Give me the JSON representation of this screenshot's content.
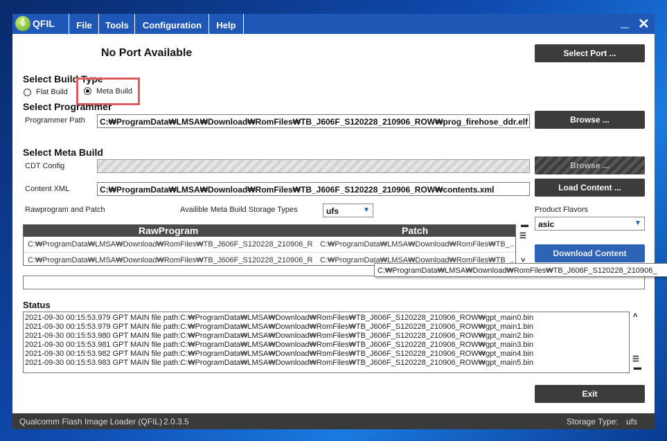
{
  "app": {
    "title": "QFIL",
    "menus": [
      "File",
      "Tools",
      "Configuration",
      "Help"
    ],
    "minimize": "_",
    "close": "✕"
  },
  "port": {
    "status": "No Port Available",
    "select_button": "Select Port ..."
  },
  "build_type": {
    "heading": "Select Build Type",
    "flat": "Flat Build",
    "meta": "Meta Build",
    "selected": "meta"
  },
  "programmer": {
    "heading": "Select Programmer",
    "path_label": "Programmer Path",
    "path_value": "C:₩ProgramData₩LMSA₩Download₩RomFiles₩TB_J606F_S120228_210906_ROW₩prog_firehose_ddr.elf",
    "browse": "Browse ..."
  },
  "meta_build": {
    "heading": "Select Meta Build",
    "cdt_label": "CDT Config",
    "cdt_browse": "Browse ...",
    "content_label": "Content XML",
    "content_value": "C:₩ProgramData₩LMSA₩Download₩RomFiles₩TB_J606F_S120228_210906_ROW₩contents.xml",
    "load_content": "Load Content ...",
    "rawprogram_label": "Rawprogram and Patch",
    "storage_label": "Availible Meta Build Storage Types",
    "storage_value": "ufs",
    "flavors_label": "Product Flavors",
    "flavors_value": "asic",
    "download_content": "Download Content"
  },
  "grid": {
    "headers": [
      "RawProgram",
      "Patch"
    ],
    "rows": [
      [
        "C:₩ProgramData₩LMSA₩Download₩RomFiles₩TB_J606F_S120228_210906_R...",
        "C:₩ProgramData₩LMSA₩Download₩RomFiles₩TB_..."
      ],
      [
        "C:₩ProgramData₩LMSA₩Download₩RomFiles₩TB_J606F_S120228_210906_R...",
        "C:₩ProgramData₩LMSA₩Download₩RomFiles₩TB_..."
      ]
    ],
    "tooltip": "C:₩ProgramData₩LMSA₩Download₩RomFiles₩TB_J606F_S120228_210906_"
  },
  "status": {
    "heading": "Status",
    "lines": [
      "2021-09-30 00:15:53.979    GPT MAIN file path:C:₩ProgramData₩LMSA₩Download₩RomFiles₩TB_J606F_S120228_210906_ROW₩gpt_main0.bin",
      "2021-09-30 00:15:53.979    GPT MAIN file path:C:₩ProgramData₩LMSA₩Download₩RomFiles₩TB_J606F_S120228_210906_ROW₩gpt_main1.bin",
      "2021-09-30 00:15:53.980    GPT MAIN file path:C:₩ProgramData₩LMSA₩Download₩RomFiles₩TB_J606F_S120228_210906_ROW₩gpt_main2.bin",
      "2021-09-30 00:15:53.981    GPT MAIN file path:C:₩ProgramData₩LMSA₩Download₩RomFiles₩TB_J606F_S120228_210906_ROW₩gpt_main3.bin",
      "2021-09-30 00:15:53.982    GPT MAIN file path:C:₩ProgramData₩LMSA₩Download₩RomFiles₩TB_J606F_S120228_210906_ROW₩gpt_main4.bin",
      "2021-09-30 00:15:53.983    GPT MAIN file path:C:₩ProgramData₩LMSA₩Download₩RomFiles₩TB_J606F_S120228_210906_ROW₩gpt_main5.bin"
    ],
    "exit": "Exit"
  },
  "footer": {
    "app_name": "Qualcomm Flash Image Loader (QFIL)",
    "version": "2.0.3.5",
    "storage_label": "Storage Type:",
    "storage_value": "ufs"
  },
  "colors": {
    "titlebar": "#1e57b5",
    "highlight": "#e05a62",
    "button": "#3c3c3c"
  }
}
